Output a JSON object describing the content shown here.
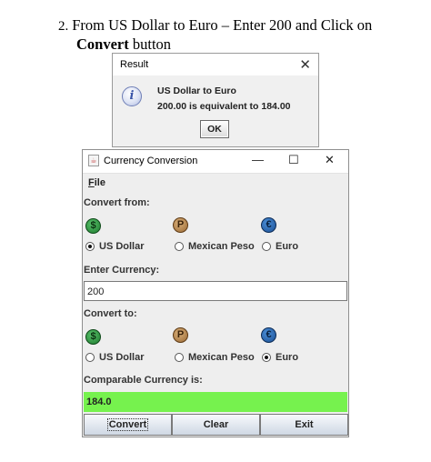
{
  "doc": {
    "number": "2.",
    "line1": "From US Dollar to Euro – Enter 200 and Click on",
    "bold_word": "Convert",
    "after_bold": " button"
  },
  "result_dialog": {
    "title": "Result",
    "close_symbol": "✕",
    "info_symbol": "i",
    "message_line1": "US Dollar to Euro",
    "message_line2": "200.00 is equivalent to 184.00",
    "ok_label": "OK"
  },
  "window": {
    "title": "Currency Conversion",
    "minimize_symbol": "—",
    "maximize_symbol": "☐",
    "close_symbol": "✕",
    "menu": {
      "file_mnemonic": "F",
      "file_rest": "ile"
    },
    "convert_from": {
      "label": "Convert from:",
      "icons": [
        {
          "name": "dollar-coin-icon",
          "symbol": "$"
        },
        {
          "name": "peso-coin-icon",
          "symbol": "P"
        },
        {
          "name": "euro-coin-icon",
          "symbol": "€"
        }
      ],
      "options": [
        {
          "label": "US Dollar",
          "selected": true
        },
        {
          "label": "Mexican Peso",
          "selected": false
        },
        {
          "label": "Euro",
          "selected": false
        }
      ]
    },
    "enter_currency": {
      "label": "Enter Currency:",
      "value": "200"
    },
    "convert_to": {
      "label": "Convert to:",
      "icons": [
        {
          "name": "dollar-coin-icon",
          "symbol": "$"
        },
        {
          "name": "peso-coin-icon",
          "symbol": "P"
        },
        {
          "name": "euro-coin-icon",
          "symbol": "€"
        }
      ],
      "options": [
        {
          "label": "US Dollar",
          "selected": false
        },
        {
          "label": "Mexican Peso",
          "selected": false
        },
        {
          "label": "Euro",
          "selected": true
        }
      ]
    },
    "comparable": {
      "label": "Comparable Currency is:",
      "value": "184.0"
    },
    "buttons": {
      "convert": "Convert",
      "clear": "Clear",
      "exit": "Exit"
    }
  },
  "colors": {
    "result_field_bg": "#76f24e",
    "dollar_coin": "#1d7a2e",
    "peso_coin": "#9b6a35",
    "euro_coin": "#1b4f94"
  }
}
